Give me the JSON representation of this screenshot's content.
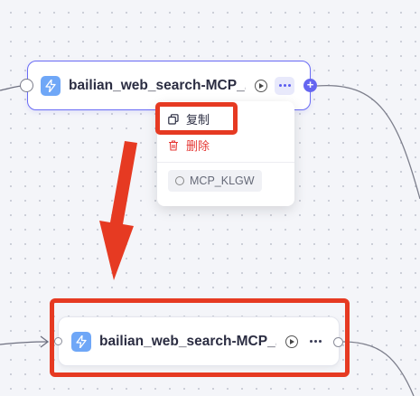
{
  "canvas": {
    "source_node": {
      "title": "bailian_web_search-MCP_...",
      "icon": "lightning-bolt-icon",
      "selected": true
    },
    "context_menu": {
      "items": [
        {
          "label": "复制",
          "icon": "copy-icon"
        },
        {
          "label": "删除",
          "icon": "trash-icon",
          "color": "#e53935"
        }
      ],
      "node_id_chip": "MCP_KLGW"
    },
    "copied_node": {
      "title": "bailian_web_search-MCP_...",
      "icon": "lightning-bolt-icon"
    }
  },
  "colors": {
    "accent": "#6566f0",
    "highlight": "#e63a22",
    "node_icon_bg": "#6fa7f7",
    "danger": "#e53935"
  }
}
